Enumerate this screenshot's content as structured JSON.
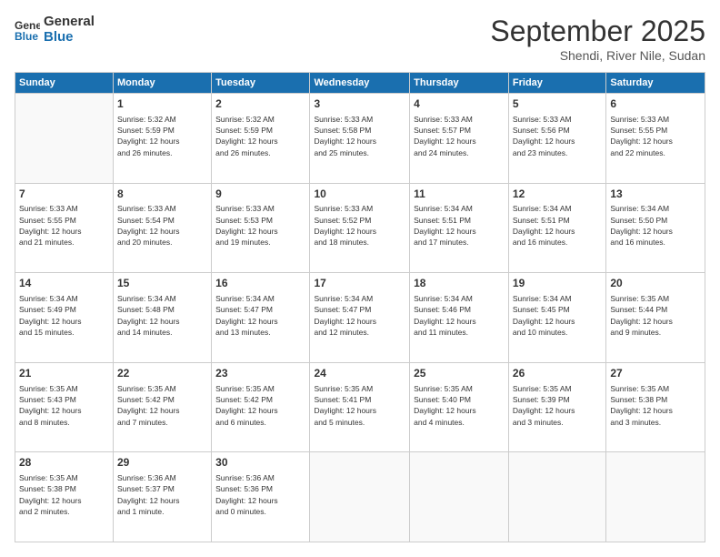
{
  "logo": {
    "line1": "General",
    "line2": "Blue"
  },
  "title": "September 2025",
  "subtitle": "Shendi, River Nile, Sudan",
  "weekdays": [
    "Sunday",
    "Monday",
    "Tuesday",
    "Wednesday",
    "Thursday",
    "Friday",
    "Saturday"
  ],
  "weeks": [
    [
      {
        "day": "",
        "info": ""
      },
      {
        "day": "1",
        "info": "Sunrise: 5:32 AM\nSunset: 5:59 PM\nDaylight: 12 hours\nand 26 minutes."
      },
      {
        "day": "2",
        "info": "Sunrise: 5:32 AM\nSunset: 5:59 PM\nDaylight: 12 hours\nand 26 minutes."
      },
      {
        "day": "3",
        "info": "Sunrise: 5:33 AM\nSunset: 5:58 PM\nDaylight: 12 hours\nand 25 minutes."
      },
      {
        "day": "4",
        "info": "Sunrise: 5:33 AM\nSunset: 5:57 PM\nDaylight: 12 hours\nand 24 minutes."
      },
      {
        "day": "5",
        "info": "Sunrise: 5:33 AM\nSunset: 5:56 PM\nDaylight: 12 hours\nand 23 minutes."
      },
      {
        "day": "6",
        "info": "Sunrise: 5:33 AM\nSunset: 5:55 PM\nDaylight: 12 hours\nand 22 minutes."
      }
    ],
    [
      {
        "day": "7",
        "info": "Sunrise: 5:33 AM\nSunset: 5:55 PM\nDaylight: 12 hours\nand 21 minutes."
      },
      {
        "day": "8",
        "info": "Sunrise: 5:33 AM\nSunset: 5:54 PM\nDaylight: 12 hours\nand 20 minutes."
      },
      {
        "day": "9",
        "info": "Sunrise: 5:33 AM\nSunset: 5:53 PM\nDaylight: 12 hours\nand 19 minutes."
      },
      {
        "day": "10",
        "info": "Sunrise: 5:33 AM\nSunset: 5:52 PM\nDaylight: 12 hours\nand 18 minutes."
      },
      {
        "day": "11",
        "info": "Sunrise: 5:34 AM\nSunset: 5:51 PM\nDaylight: 12 hours\nand 17 minutes."
      },
      {
        "day": "12",
        "info": "Sunrise: 5:34 AM\nSunset: 5:51 PM\nDaylight: 12 hours\nand 16 minutes."
      },
      {
        "day": "13",
        "info": "Sunrise: 5:34 AM\nSunset: 5:50 PM\nDaylight: 12 hours\nand 16 minutes."
      }
    ],
    [
      {
        "day": "14",
        "info": "Sunrise: 5:34 AM\nSunset: 5:49 PM\nDaylight: 12 hours\nand 15 minutes."
      },
      {
        "day": "15",
        "info": "Sunrise: 5:34 AM\nSunset: 5:48 PM\nDaylight: 12 hours\nand 14 minutes."
      },
      {
        "day": "16",
        "info": "Sunrise: 5:34 AM\nSunset: 5:47 PM\nDaylight: 12 hours\nand 13 minutes."
      },
      {
        "day": "17",
        "info": "Sunrise: 5:34 AM\nSunset: 5:47 PM\nDaylight: 12 hours\nand 12 minutes."
      },
      {
        "day": "18",
        "info": "Sunrise: 5:34 AM\nSunset: 5:46 PM\nDaylight: 12 hours\nand 11 minutes."
      },
      {
        "day": "19",
        "info": "Sunrise: 5:34 AM\nSunset: 5:45 PM\nDaylight: 12 hours\nand 10 minutes."
      },
      {
        "day": "20",
        "info": "Sunrise: 5:35 AM\nSunset: 5:44 PM\nDaylight: 12 hours\nand 9 minutes."
      }
    ],
    [
      {
        "day": "21",
        "info": "Sunrise: 5:35 AM\nSunset: 5:43 PM\nDaylight: 12 hours\nand 8 minutes."
      },
      {
        "day": "22",
        "info": "Sunrise: 5:35 AM\nSunset: 5:42 PM\nDaylight: 12 hours\nand 7 minutes."
      },
      {
        "day": "23",
        "info": "Sunrise: 5:35 AM\nSunset: 5:42 PM\nDaylight: 12 hours\nand 6 minutes."
      },
      {
        "day": "24",
        "info": "Sunrise: 5:35 AM\nSunset: 5:41 PM\nDaylight: 12 hours\nand 5 minutes."
      },
      {
        "day": "25",
        "info": "Sunrise: 5:35 AM\nSunset: 5:40 PM\nDaylight: 12 hours\nand 4 minutes."
      },
      {
        "day": "26",
        "info": "Sunrise: 5:35 AM\nSunset: 5:39 PM\nDaylight: 12 hours\nand 3 minutes."
      },
      {
        "day": "27",
        "info": "Sunrise: 5:35 AM\nSunset: 5:38 PM\nDaylight: 12 hours\nand 3 minutes."
      }
    ],
    [
      {
        "day": "28",
        "info": "Sunrise: 5:35 AM\nSunset: 5:38 PM\nDaylight: 12 hours\nand 2 minutes."
      },
      {
        "day": "29",
        "info": "Sunrise: 5:36 AM\nSunset: 5:37 PM\nDaylight: 12 hours\nand 1 minute."
      },
      {
        "day": "30",
        "info": "Sunrise: 5:36 AM\nSunset: 5:36 PM\nDaylight: 12 hours\nand 0 minutes."
      },
      {
        "day": "",
        "info": ""
      },
      {
        "day": "",
        "info": ""
      },
      {
        "day": "",
        "info": ""
      },
      {
        "day": "",
        "info": ""
      }
    ]
  ]
}
